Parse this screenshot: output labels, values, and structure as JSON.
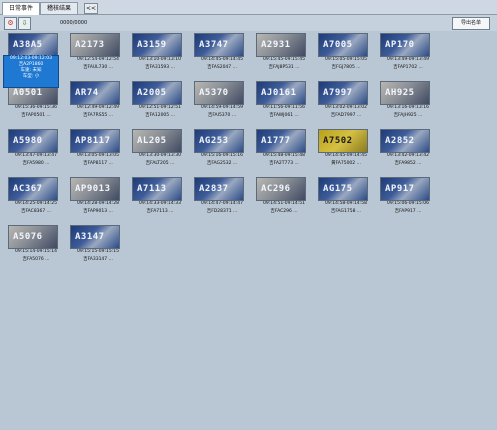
{
  "tabs": [
    {
      "label": "日常事件"
    },
    {
      "label": "稽核结果"
    }
  ],
  "collapse_label": "<<",
  "toolbar": {
    "counter": "0000/0000",
    "export_label": "导出名单"
  },
  "tooltip": {
    "time": "09:12:03-09:12:03",
    "lp": "吉A2P1860",
    "speed": "车速: 未知",
    "type": "车型: 小"
  },
  "cards": [
    {
      "plate": "A38A5",
      "time": "",
      "lp": ""
    },
    {
      "plate": "A2173",
      "time": "09:12:54-09:12:54",
      "lp": "吉FAUL730 ..."
    },
    {
      "plate": "A3159",
      "time": "09:13:10-09:13:10",
      "lp": "吉FA31593 ..."
    },
    {
      "plate": "A3747",
      "time": "09:14:45-09:14:45",
      "lp": "吉FAS2047 ..."
    },
    {
      "plate": "A2931",
      "time": "09:15:45-09:15:45",
      "lp": "吉FAJ8P531 ..."
    },
    {
      "plate": "A7005",
      "time": "09:15:05-09:15:05",
      "lp": "吉FGJ7805 ..."
    },
    {
      "plate": "AP170",
      "time": "09:13:49-09:13:49",
      "lp": "吉FAP1702 ..."
    },
    {
      "plate": "A0501",
      "time": "09:15:36-09:15:36",
      "lp": "吉FAP0501 ..."
    },
    {
      "plate": "AR74",
      "time": "09:12:49-09:12:49",
      "lp": "吉FA7RS55 ..."
    },
    {
      "plate": "A2005",
      "time": "09:12:51-09:12:51",
      "lp": "吉FA12005 ..."
    },
    {
      "plate": "A5370",
      "time": "09:14:59-09:14:59",
      "lp": "吉FAI5370 ..."
    },
    {
      "plate": "AJ0161",
      "time": "09:11:56-09:11:56",
      "lp": "吉FAWJ061 ..."
    },
    {
      "plate": "A7997",
      "time": "09:13:02-09:13:02",
      "lp": "吉FAD7997 ..."
    },
    {
      "plate": "AH925",
      "time": "09:13:16-09:13:16",
      "lp": "吉FAJH925 ..."
    },
    {
      "plate": "A5980",
      "time": "09:13:47-09:13:47",
      "lp": "吉FA5980 ..."
    },
    {
      "plate": "AP8117",
      "time": "09:13:05-09:13:05",
      "lp": "吉FAP8117 ..."
    },
    {
      "plate": "AL205",
      "time": "09:13:30-09:13:30",
      "lp": "吉FALT205 ..."
    },
    {
      "plate": "AG253",
      "time": "09:15:16-09:15:16",
      "lp": "吉FAG2532 ..."
    },
    {
      "plate": "A1777",
      "time": "09:15:48-09:15:48",
      "lp": "吉FA2T773 ..."
    },
    {
      "plate": "A7502",
      "time": "09:14:45-09:14:45",
      "lp": "黄FA75002 ..."
    },
    {
      "plate": "A2852",
      "time": "09:13:42-09:13:42",
      "lp": "吉FA9852 ..."
    },
    {
      "plate": "AC367",
      "time": "09:14:25-09:14:25",
      "lp": "吉FAC8367 ..."
    },
    {
      "plate": "AP9013",
      "time": "09:14:28-09:14:28",
      "lp": "吉FAP9013 ..."
    },
    {
      "plate": "A7113",
      "time": "09:14:33-09:14:33",
      "lp": "吉FA7113 ..."
    },
    {
      "plate": "A2837",
      "time": "09:14:47-09:14:47",
      "lp": "吉FD28371 ..."
    },
    {
      "plate": "AC296",
      "time": "09:14:51-09:14:51",
      "lp": "吉FAC296 ..."
    },
    {
      "plate": "AG175",
      "time": "09:14:58-09:14:58",
      "lp": "吉FAG1758 ..."
    },
    {
      "plate": "AP917",
      "time": "09:15:06-09:15:06",
      "lp": "吉FAP917 ..."
    },
    {
      "plate": "A5076",
      "time": "09:15:14-09:15:14",
      "lp": "吉FA5076 ..."
    },
    {
      "plate": "A3147",
      "time": "09:15:15-09:15:15",
      "lp": "吉FA33147 ..."
    }
  ]
}
